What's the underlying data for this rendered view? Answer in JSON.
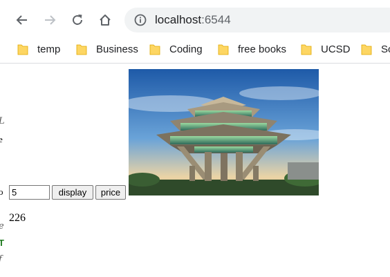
{
  "browser": {
    "url_host": "localhost",
    "url_port": ":6544",
    "bookmarks": [
      {
        "label": "temp"
      },
      {
        "label": "Business"
      },
      {
        "label": "Coding"
      },
      {
        "label": "free books"
      },
      {
        "label": "UCSD"
      },
      {
        "label": "Sc"
      }
    ],
    "colors": {
      "folder": "#fdd663",
      "folder_edge": "#e0a800",
      "icon": "#5f6368",
      "omnibox": "#f1f3f4"
    }
  },
  "page": {
    "left_fragments": [
      "L",
      "e",
      "o",
      "e",
      "T",
      "f"
    ],
    "photo_icon": "building-photo",
    "quantity_value": "5",
    "display_label": "display",
    "price_label": "price",
    "result": "226"
  }
}
